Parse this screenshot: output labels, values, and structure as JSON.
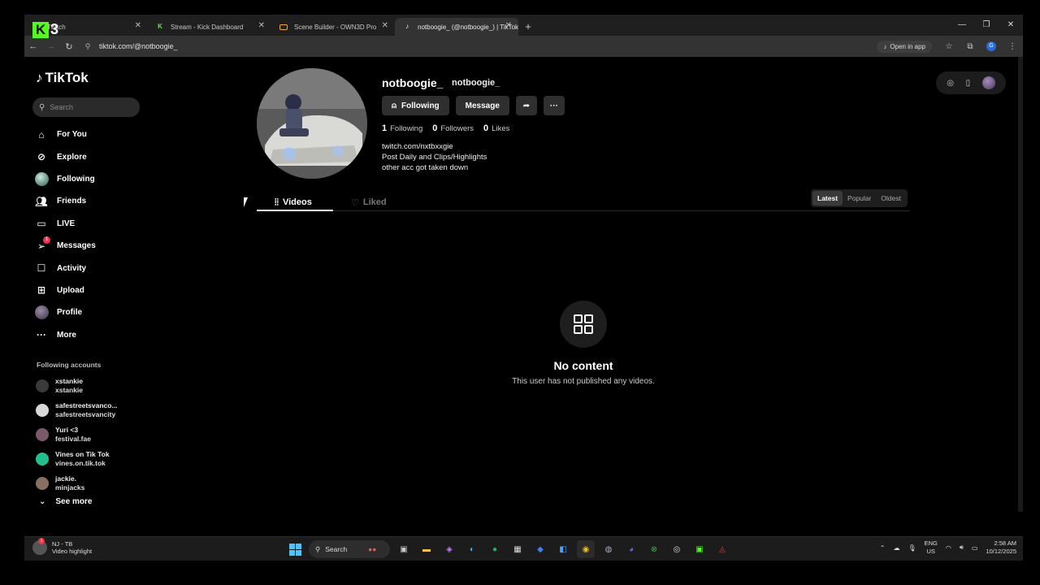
{
  "overlay": {
    "kick_number": "3"
  },
  "browser": {
    "tabs": [
      {
        "title": "Twitch",
        "active": false,
        "color": "#9146ff"
      },
      {
        "title": "Stream - Kick Dashboard",
        "active": false,
        "color": "#53fc18"
      },
      {
        "title": "Scene Builder - OWN3D Pro",
        "active": false,
        "color": "#f5a623"
      },
      {
        "title": "notboogie_ (@notboogie_) | TikTok",
        "active": true,
        "color": "#ffffff"
      }
    ],
    "url": "tiktok.com/@notboogie_",
    "open_in_app": "Open in app",
    "profile_letter": "G"
  },
  "sidebar": {
    "brand": "TikTok",
    "search_placeholder": "Search",
    "nav": [
      {
        "label": "For You",
        "icon": "home-icon"
      },
      {
        "label": "Explore",
        "icon": "compass-icon"
      },
      {
        "label": "Following",
        "icon": "following-avatar-icon"
      },
      {
        "label": "Friends",
        "icon": "friends-icon"
      },
      {
        "label": "LIVE",
        "icon": "live-icon"
      },
      {
        "label": "Messages",
        "icon": "send-icon",
        "badge": "1"
      },
      {
        "label": "Activity",
        "icon": "activity-icon"
      },
      {
        "label": "Upload",
        "icon": "upload-icon"
      },
      {
        "label": "Profile",
        "icon": "profile-avatar-icon"
      },
      {
        "label": "More",
        "icon": "more-icon"
      }
    ],
    "following_heading": "Following accounts",
    "accounts": [
      {
        "name": "xstankie",
        "handle": "xstankie",
        "color": "#3a3a3a"
      },
      {
        "name": "safestreetsvanco...",
        "handle": "safestreetsvancity",
        "color": "#d8d8d8"
      },
      {
        "name": "Yuri <3",
        "handle": "festival.fae",
        "color": "#7a5a6a"
      },
      {
        "name": "Vines on Tik Tok",
        "handle": "vines.on.tik.tok",
        "color": "#1fbf8f"
      },
      {
        "name": "jackie.",
        "handle": "minjacks",
        "color": "#8a6f5f"
      }
    ],
    "see_more": "See more"
  },
  "profile": {
    "username": "notboogie_",
    "nickname": "notboogie_",
    "buttons": {
      "following": "Following",
      "message": "Message"
    },
    "stats": [
      {
        "value": "1",
        "label": "Following"
      },
      {
        "value": "0",
        "label": "Followers"
      },
      {
        "value": "0",
        "label": "Likes"
      }
    ],
    "bio": [
      "twitch.com/nxtbxxgie",
      "Post Daily and Clips/Highlights",
      "other acc got taken down"
    ],
    "tabs": {
      "videos": "Videos",
      "liked": "Liked"
    },
    "sort": [
      "Latest",
      "Popular",
      "Oldest"
    ],
    "empty_title": "No content",
    "empty_desc": "This user has not published any videos."
  },
  "taskbar": {
    "notif_title": "NJ - TB",
    "notif_sub": "Video highlight",
    "notif_badge": "1",
    "search": "Search",
    "lang_top": "ENG",
    "lang_bottom": "US",
    "time": "2:58 AM",
    "date": "10/12/2025"
  },
  "colors": {
    "accent": "#fe2c55",
    "kick": "#53fc18"
  }
}
